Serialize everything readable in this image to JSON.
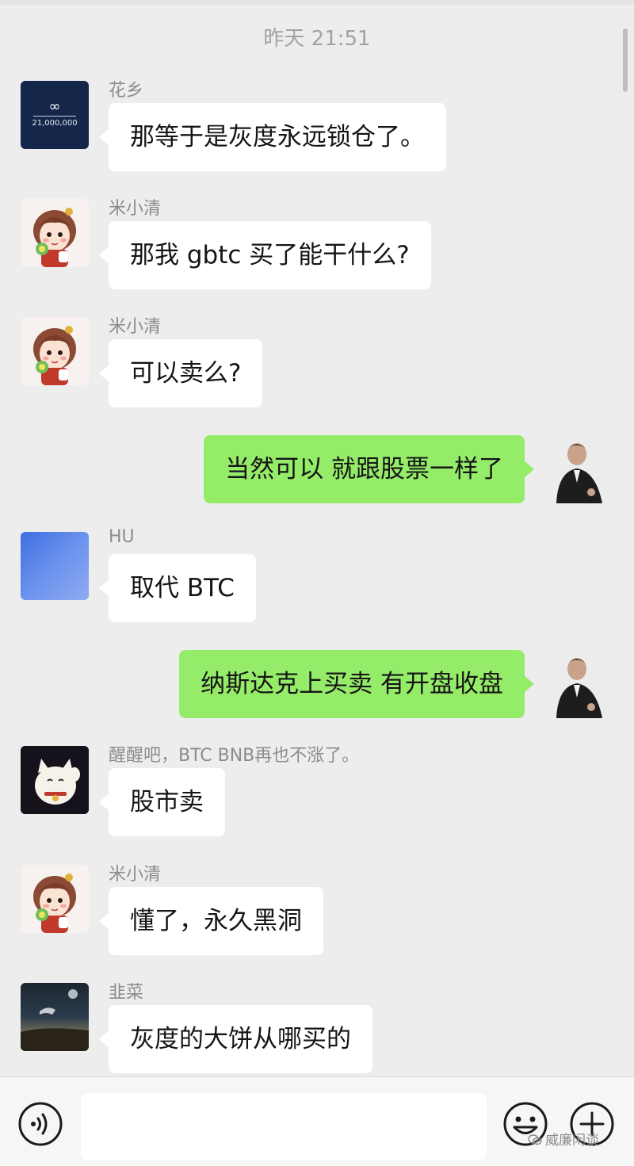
{
  "timestamp": "昨天 21:51",
  "messages": [
    {
      "side": "left",
      "sender": "花乡",
      "text": "那等于是灰度永远锁仓了。",
      "avatar": "grid-logo-avatar",
      "avatar_caption": "21,000,000"
    },
    {
      "side": "left",
      "sender": "米小清",
      "text": "那我 gbtc 买了能干什么?",
      "avatar": "cartoon-girl-avatar"
    },
    {
      "side": "left",
      "sender": "米小清",
      "text": "可以卖么?",
      "avatar": "cartoon-girl-avatar"
    },
    {
      "side": "right",
      "text": "当然可以 就跟股票一样了",
      "avatar": "man-in-suit-avatar"
    },
    {
      "side": "left",
      "sender": "HU",
      "text": "取代 BTC",
      "avatar": "blue-gradient-avatar"
    },
    {
      "side": "right",
      "text": "纳斯达克上买卖 有开盘收盘",
      "avatar": "man-in-suit-avatar"
    },
    {
      "side": "left",
      "sender": "醒醒吧，BTC BNB再也不涨了。",
      "text": "股市卖",
      "avatar": "lucky-cat-avatar"
    },
    {
      "side": "left",
      "sender": "米小清",
      "text": "懂了，永久黑洞",
      "avatar": "cartoon-girl-avatar"
    },
    {
      "side": "left",
      "sender": "韭菜",
      "text": "灰度的大饼从哪买的",
      "avatar": "night-landscape-avatar"
    }
  ],
  "input": {
    "placeholder": ""
  },
  "watermark": "威廉闲谈",
  "colors": {
    "background": "#ededed",
    "incoming_bubble": "#ffffff",
    "outgoing_bubble": "#95ec69",
    "timestamp": "#a2a2a2"
  },
  "icons": {
    "voice": "voice-icon",
    "emoji": "emoji-icon",
    "plus": "plus-icon"
  }
}
